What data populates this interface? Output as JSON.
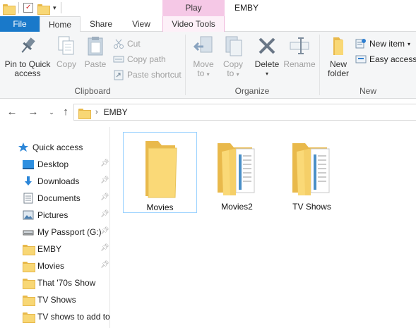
{
  "window": {
    "title": "EMBY",
    "context_tab_group": "Play"
  },
  "tabs": {
    "file": "File",
    "home": "Home",
    "share": "Share",
    "view": "View",
    "video_tools": "Video Tools"
  },
  "ribbon": {
    "clipboard": {
      "label": "Clipboard",
      "pin_to_quick_access_line1": "Pin to Quick",
      "pin_to_quick_access_line2": "access",
      "copy": "Copy",
      "paste": "Paste",
      "cut": "Cut",
      "copy_path": "Copy path",
      "paste_shortcut": "Paste shortcut"
    },
    "organize": {
      "label": "Organize",
      "move_to_line1": "Move",
      "move_to_line2": "to",
      "copy_to_line1": "Copy",
      "copy_to_line2": "to",
      "delete": "Delete",
      "rename": "Rename"
    },
    "new": {
      "label": "New",
      "new_folder_line1": "New",
      "new_folder_line2": "folder",
      "new_item": "New item",
      "easy_access": "Easy access"
    }
  },
  "address": {
    "path": [
      "EMBY"
    ]
  },
  "nav_pane": {
    "quick_access": "Quick access",
    "items": [
      {
        "label": "Desktop",
        "icon": "desktop-icon",
        "pinned": true
      },
      {
        "label": "Downloads",
        "icon": "downloads-icon",
        "pinned": true
      },
      {
        "label": "Documents",
        "icon": "documents-icon",
        "pinned": true
      },
      {
        "label": "Pictures",
        "icon": "pictures-icon",
        "pinned": true
      },
      {
        "label": "My Passport (G:)",
        "icon": "drive-icon",
        "pinned": true
      },
      {
        "label": "EMBY",
        "icon": "folder-icon",
        "pinned": true
      },
      {
        "label": "Movies",
        "icon": "folder-icon",
        "pinned": true
      },
      {
        "label": "That '70s Show",
        "icon": "folder-icon",
        "pinned": false
      },
      {
        "label": "TV Shows",
        "icon": "folder-icon",
        "pinned": false
      },
      {
        "label": "TV shows to add to",
        "icon": "folder-icon",
        "pinned": false
      }
    ]
  },
  "files": [
    {
      "name": "Movies",
      "selected": true,
      "has_contents_preview": false
    },
    {
      "name": "Movies2",
      "selected": false,
      "has_contents_preview": true
    },
    {
      "name": "TV Shows",
      "selected": false,
      "has_contents_preview": true
    }
  ],
  "colors": {
    "file_tab": "#1979ca",
    "context_tab": "#f5c8e6",
    "folder": "#f8d775",
    "selection_border": "#99d1ff"
  }
}
